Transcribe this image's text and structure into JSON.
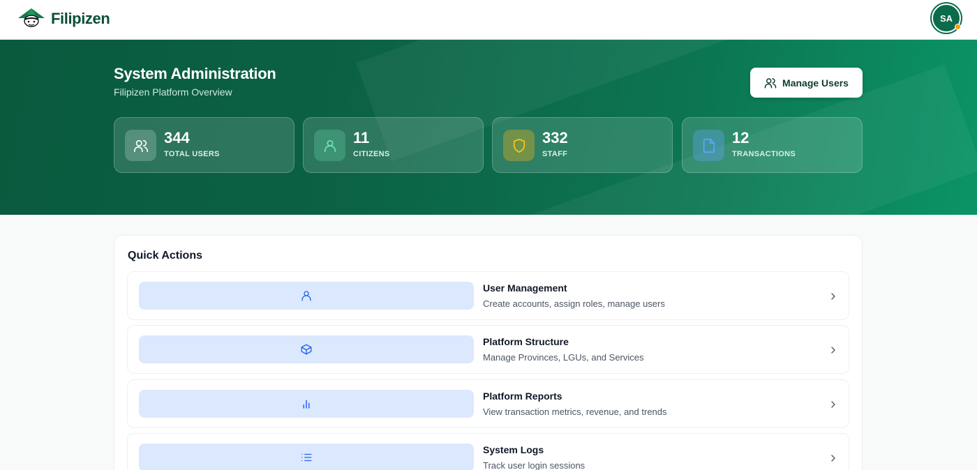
{
  "app": {
    "brand_name": "Filipizen",
    "avatar_initials": "SA"
  },
  "hero": {
    "title": "System Administration",
    "subtitle": "Filipizen Platform Overview",
    "manage_button_label": "Manage Users"
  },
  "stats": [
    {
      "value": "344",
      "label": "TOTAL USERS",
      "icon": "users-icon",
      "color": "#ffffff"
    },
    {
      "value": "11",
      "label": "CITIZENS",
      "icon": "user-icon",
      "color": "#6ee7b7"
    },
    {
      "value": "332",
      "label": "STAFF",
      "icon": "shield-icon",
      "color": "#facc15"
    },
    {
      "value": "12",
      "label": "TRANSACTIONS",
      "icon": "file-icon",
      "color": "#60a5fa"
    }
  ],
  "quick_actions": {
    "title": "Quick Actions",
    "items": [
      {
        "title": "User Management",
        "description": "Create accounts, assign roles, manage users",
        "icon": "user-icon"
      },
      {
        "title": "Platform Structure",
        "description": "Manage Provinces, LGUs, and Services",
        "icon": "box-icon"
      },
      {
        "title": "Platform Reports",
        "description": "View transaction metrics, revenue, and trends",
        "icon": "bar-chart-icon"
      },
      {
        "title": "System Logs",
        "description": "Track user login sessions",
        "icon": "list-icon"
      }
    ]
  },
  "colors": {
    "brand_dark": "#0b4f3a",
    "hero_start": "#0a5a3e",
    "hero_end": "#0b9466",
    "action_icon_bg": "#dbe8fd",
    "action_icon_fg": "#2563eb",
    "avatar_status": "#f59e0b"
  }
}
